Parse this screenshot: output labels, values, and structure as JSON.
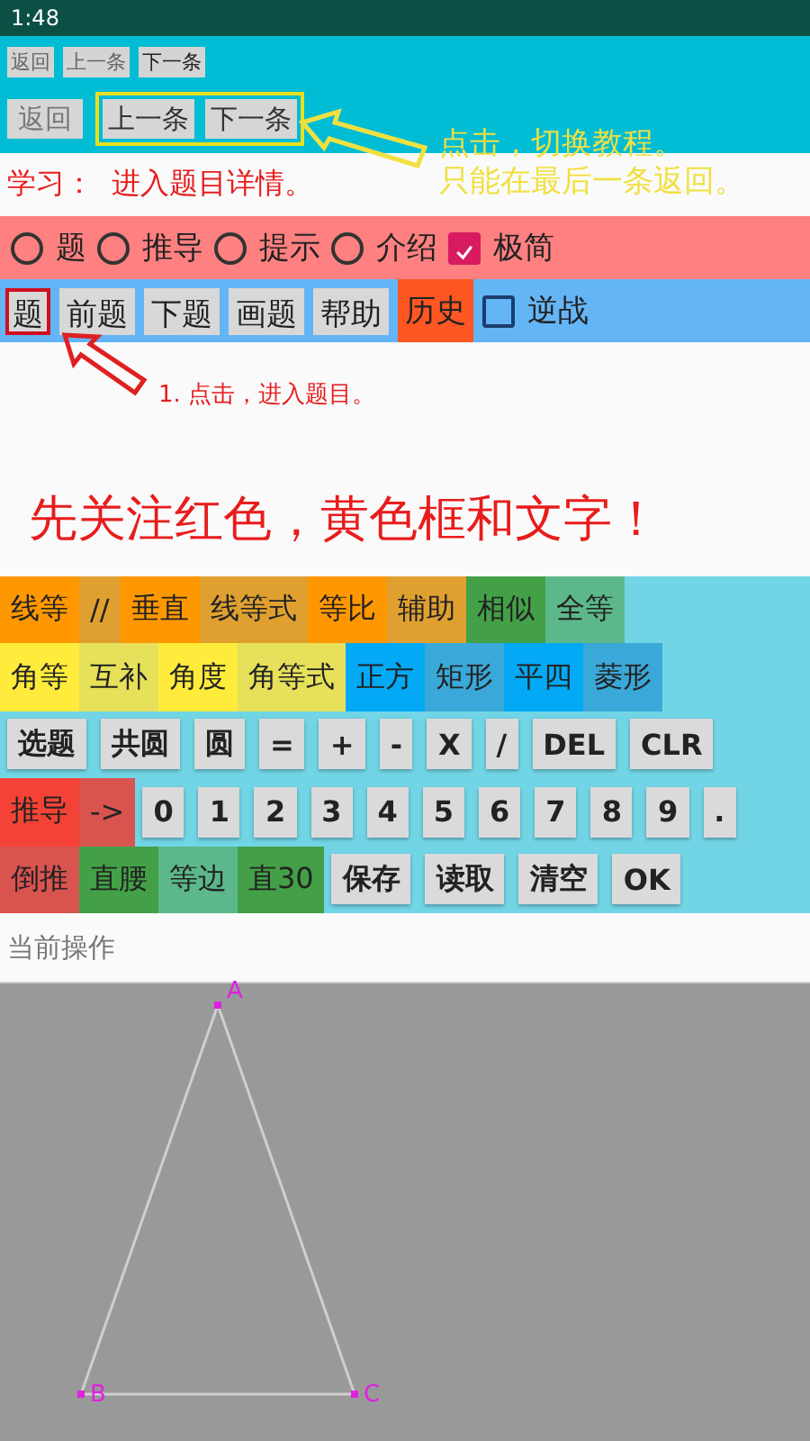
{
  "status_bar": {
    "time": "1:48"
  },
  "nav_small": [
    {
      "label": "返回",
      "disabled": true
    },
    {
      "label": "上一条",
      "disabled": true
    },
    {
      "label": "下一条",
      "disabled": false
    }
  ],
  "nav_large": {
    "back": {
      "label": "返回",
      "disabled": true
    },
    "highlighted": true,
    "buttons": [
      {
        "label": "上一条",
        "disabled": false
      },
      {
        "label": "下一条",
        "disabled": false
      }
    ]
  },
  "tip_top": [
    "点击，切换教程。",
    "只能在最后一条返回。"
  ],
  "lesson": "学习：  进入题目详情。",
  "modes": [
    {
      "kind": "radio",
      "label": "题",
      "selected": false
    },
    {
      "kind": "radio",
      "label": "推导",
      "selected": false
    },
    {
      "kind": "radio",
      "label": "提示",
      "selected": false
    },
    {
      "kind": "radio",
      "label": "介绍",
      "selected": false
    },
    {
      "kind": "checkbox",
      "label": "极简",
      "checked": true
    }
  ],
  "toolbar": [
    {
      "kind": "button",
      "label": "题",
      "highlighted": true
    },
    {
      "kind": "button",
      "label": "前题",
      "highlighted": false
    },
    {
      "kind": "button",
      "label": "下题",
      "highlighted": false
    },
    {
      "kind": "button",
      "label": "画题",
      "highlighted": false
    },
    {
      "kind": "button",
      "label": "帮助",
      "highlighted": false
    },
    {
      "kind": "tile",
      "label": "历史",
      "color": "#ff5722"
    },
    {
      "kind": "checkbox",
      "label": "逆战",
      "checked": false
    }
  ],
  "tip_step": "1. 点击，进入题目。",
  "headline": "先关注红色，黄色框和文字！",
  "keypad": [
    [
      {
        "kind": "tile",
        "label": "线等",
        "color": "#ff9800"
      },
      {
        "kind": "tile",
        "label": "//",
        "color": "#e0a030"
      },
      {
        "kind": "tile",
        "label": "垂直",
        "color": "#ff9800"
      },
      {
        "kind": "tile",
        "label": "线等式",
        "color": "#e0a030"
      },
      {
        "kind": "tile",
        "label": "等比",
        "color": "#ff9800"
      },
      {
        "kind": "tile",
        "label": "辅助",
        "color": "#e0a030"
      },
      {
        "kind": "tile",
        "label": "相似",
        "color": "#43a047"
      },
      {
        "kind": "tile",
        "label": "全等",
        "color": "#5cb88a"
      }
    ],
    [
      {
        "kind": "tile",
        "label": "角等",
        "color": "#ffeb3b"
      },
      {
        "kind": "tile",
        "label": "互补",
        "color": "#e6e05a"
      },
      {
        "kind": "tile",
        "label": "角度",
        "color": "#ffeb3b"
      },
      {
        "kind": "tile",
        "label": "角等式",
        "color": "#e6e05a"
      },
      {
        "kind": "tile",
        "label": "正方",
        "color": "#03a9f4"
      },
      {
        "kind": "tile",
        "label": "矩形",
        "color": "#3aa8d8"
      },
      {
        "kind": "tile",
        "label": "平四",
        "color": "#03a9f4"
      },
      {
        "kind": "tile",
        "label": "菱形",
        "color": "#3aa8d8"
      }
    ],
    [
      {
        "kind": "key",
        "label": "选题"
      },
      {
        "kind": "key",
        "label": "共圆"
      },
      {
        "kind": "key",
        "label": "圆"
      },
      {
        "kind": "key",
        "label": "="
      },
      {
        "kind": "key",
        "label": "+"
      },
      {
        "kind": "key",
        "label": "-"
      },
      {
        "kind": "key",
        "label": "X"
      },
      {
        "kind": "key",
        "label": "/"
      },
      {
        "kind": "key",
        "label": "DEL"
      },
      {
        "kind": "key",
        "label": "CLR"
      }
    ],
    [
      {
        "kind": "tile",
        "label": "推导",
        "color": "#f44336"
      },
      {
        "kind": "tile",
        "label": "->",
        "color": "#d9534f"
      },
      {
        "kind": "key",
        "label": "0"
      },
      {
        "kind": "key",
        "label": "1"
      },
      {
        "kind": "key",
        "label": "2"
      },
      {
        "kind": "key",
        "label": "3"
      },
      {
        "kind": "key",
        "label": "4"
      },
      {
        "kind": "key",
        "label": "5"
      },
      {
        "kind": "key",
        "label": "6"
      },
      {
        "kind": "key",
        "label": "7"
      },
      {
        "kind": "key",
        "label": "8"
      },
      {
        "kind": "key",
        "label": "9"
      },
      {
        "kind": "key",
        "label": "."
      }
    ],
    [
      {
        "kind": "tile",
        "label": "倒推",
        "color": "#d9534f"
      },
      {
        "kind": "tile",
        "label": "直腰",
        "color": "#43a047"
      },
      {
        "kind": "tile",
        "label": "等边",
        "color": "#5cb88a"
      },
      {
        "kind": "tile",
        "label": "直30",
        "color": "#43a047"
      },
      {
        "kind": "key",
        "label": "保存"
      },
      {
        "kind": "key",
        "label": "读取"
      },
      {
        "kind": "key",
        "label": "清空"
      },
      {
        "kind": "key",
        "label": "OK"
      }
    ]
  ],
  "operation_label": "当前操作",
  "canvas": {
    "points": [
      "A",
      "B",
      "C"
    ]
  }
}
